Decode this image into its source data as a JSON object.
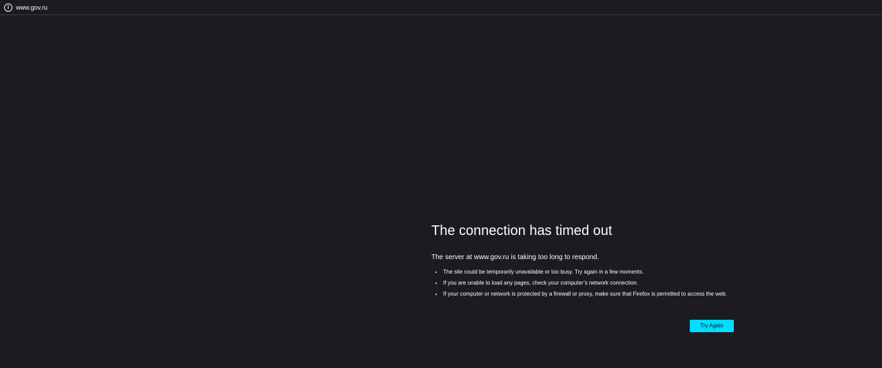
{
  "url_bar": {
    "icon": "info-icon",
    "url": "www.gov.ru"
  },
  "error": {
    "title": "The connection has timed out",
    "description": "The server at www.gov.ru is taking too long to respond.",
    "suggestions": [
      "The site could be temporarily unavailable or too busy. Try again in a few moments.",
      "If you are unable to load any pages, check your computer’s network connection.",
      "If your computer or network is protected by a firewall or proxy, make sure that Firefox is permitted to access the web."
    ],
    "button_label": "Try Again"
  },
  "colors": {
    "background": "#1c1b22",
    "text": "#fbfbfe",
    "accent": "#00ddff"
  }
}
